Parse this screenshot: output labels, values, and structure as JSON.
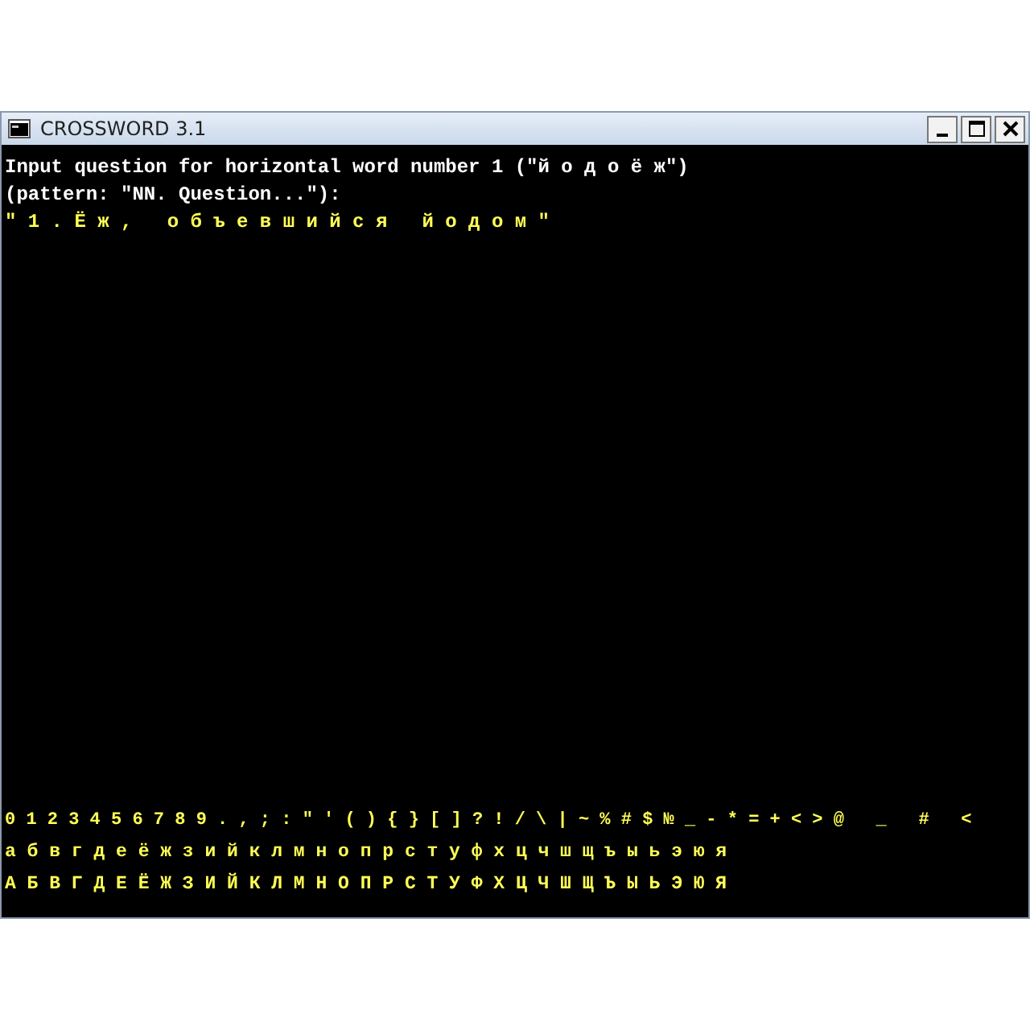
{
  "window": {
    "title": "CROSSWORD 3.1"
  },
  "console": {
    "lines": [
      {
        "text": "Input question for horizontal word number 1 (\"й о д о ё ж\")",
        "kind": "prompt"
      },
      {
        "text": "(pattern: \"NN. Question...\"):",
        "kind": "prompt"
      },
      {
        "text": "\" 1 . Ё ж ,   о б ъ е в ш и й с я   й о д о м \"",
        "kind": "input"
      }
    ],
    "palette": [
      "0 1 2 3 4 5 6 7 8 9 . , ; : \" ' ( ) { } [ ] ? ! / \\ | ~ % # $ № _ - * = + < > @   _   #   <",
      "а б в г д е ё ж з и й к л м н о п р с т у ф х ц ч ш щ ъ ы ь э ю я",
      "А Б В Г Д Е Ё Ж З И Й К Л М Н О П Р С Т У Ф Х Ц Ч Ш Щ Ъ Ы Ь Э Ю Я"
    ]
  }
}
